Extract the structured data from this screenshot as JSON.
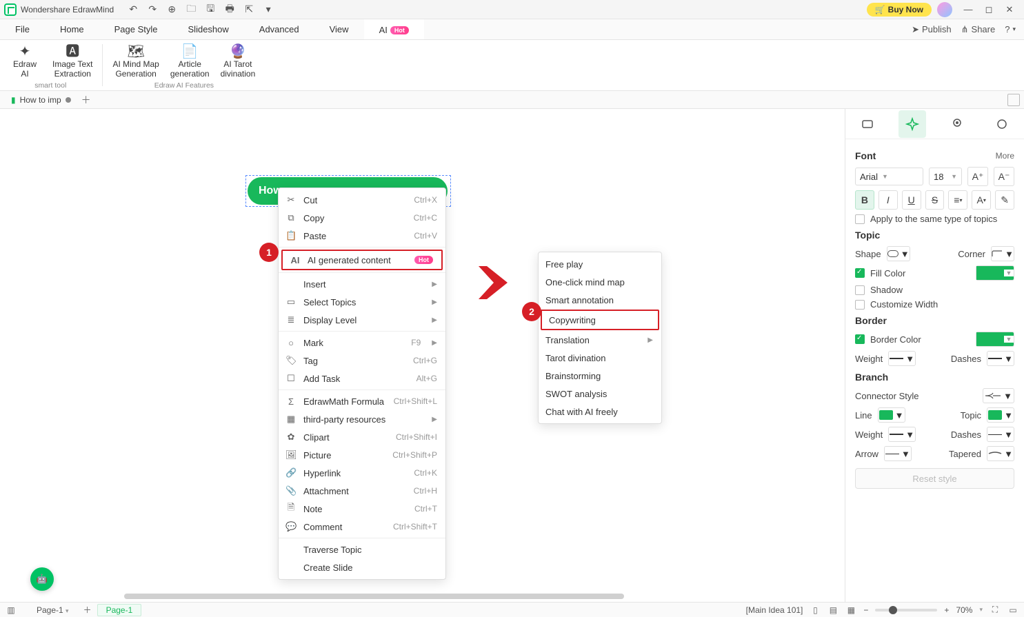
{
  "titlebar": {
    "app_name": "Wondershare EdrawMind",
    "buy_now": "Buy Now"
  },
  "menubar": {
    "items": [
      "File",
      "Home",
      "Page Style",
      "Slideshow",
      "Advanced",
      "View"
    ],
    "ai_label": "AI",
    "hot": "Hot",
    "publish": "Publish",
    "share": "Share"
  },
  "ribbon": {
    "group1": {
      "btn1": "Edraw\nAI",
      "btn2": "Image Text\nExtraction",
      "label": "smart tool"
    },
    "group2": {
      "btn1": "AI Mind Map\nGeneration",
      "btn2": "Article\ngeneration",
      "btn3": "AI Tarot\ndivination",
      "label": "Edraw AI Features"
    }
  },
  "doctabs": {
    "tab1": "How to imp"
  },
  "canvas": {
    "topic_text": "How",
    "badge1": "1",
    "badge2": "2"
  },
  "context_menu": {
    "cut": {
      "l": "Cut",
      "s": "Ctrl+X"
    },
    "copy": {
      "l": "Copy",
      "s": "Ctrl+C"
    },
    "paste": {
      "l": "Paste",
      "s": "Ctrl+V"
    },
    "ai_gen": {
      "l": "AI generated content",
      "hot": "Hot"
    },
    "insert": {
      "l": "Insert"
    },
    "select_topics": {
      "l": "Select Topics"
    },
    "display_level": {
      "l": "Display Level"
    },
    "mark": {
      "l": "Mark",
      "s": "F9"
    },
    "tag": {
      "l": "Tag",
      "s": "Ctrl+G"
    },
    "add_task": {
      "l": "Add Task",
      "s": "Alt+G"
    },
    "edrawmath": {
      "l": "EdrawMath Formula",
      "s": "Ctrl+Shift+L"
    },
    "third_party": {
      "l": "third-party resources"
    },
    "clipart": {
      "l": "Clipart",
      "s": "Ctrl+Shift+I"
    },
    "picture": {
      "l": "Picture",
      "s": "Ctrl+Shift+P"
    },
    "hyperlink": {
      "l": "Hyperlink",
      "s": "Ctrl+K"
    },
    "attachment": {
      "l": "Attachment",
      "s": "Ctrl+H"
    },
    "note": {
      "l": "Note",
      "s": "Ctrl+T"
    },
    "comment": {
      "l": "Comment",
      "s": "Ctrl+Shift+T"
    },
    "traverse": {
      "l": "Traverse Topic"
    },
    "create_slide": {
      "l": "Create Slide"
    }
  },
  "submenu": {
    "free_play": "Free play",
    "one_click": "One-click mind map",
    "smart_annot": "Smart annotation",
    "copywriting": "Copywriting",
    "translation": "Translation",
    "tarot": "Tarot divination",
    "brainstorm": "Brainstorming",
    "swot": "SWOT analysis",
    "chat": "Chat with AI freely"
  },
  "right_panel": {
    "font": {
      "title": "Font",
      "more": "More",
      "family": "Arial",
      "size": "18",
      "apply": "Apply to the same type of topics"
    },
    "topic": {
      "title": "Topic",
      "shape": "Shape",
      "corner": "Corner",
      "fill": "Fill Color",
      "shadow": "Shadow",
      "custom": "Customize Width"
    },
    "border": {
      "title": "Border",
      "color": "Border Color",
      "weight": "Weight",
      "dashes": "Dashes"
    },
    "branch": {
      "title": "Branch",
      "connector": "Connector Style",
      "line": "Line",
      "topic": "Topic",
      "weight": "Weight",
      "dashes": "Dashes",
      "arrow": "Arrow",
      "tapered": "Tapered"
    },
    "reset": "Reset style"
  },
  "statusbar": {
    "page_a": "Page-1",
    "page_b": "Page-1",
    "info": "[Main Idea 101]",
    "zoom": "70%"
  }
}
